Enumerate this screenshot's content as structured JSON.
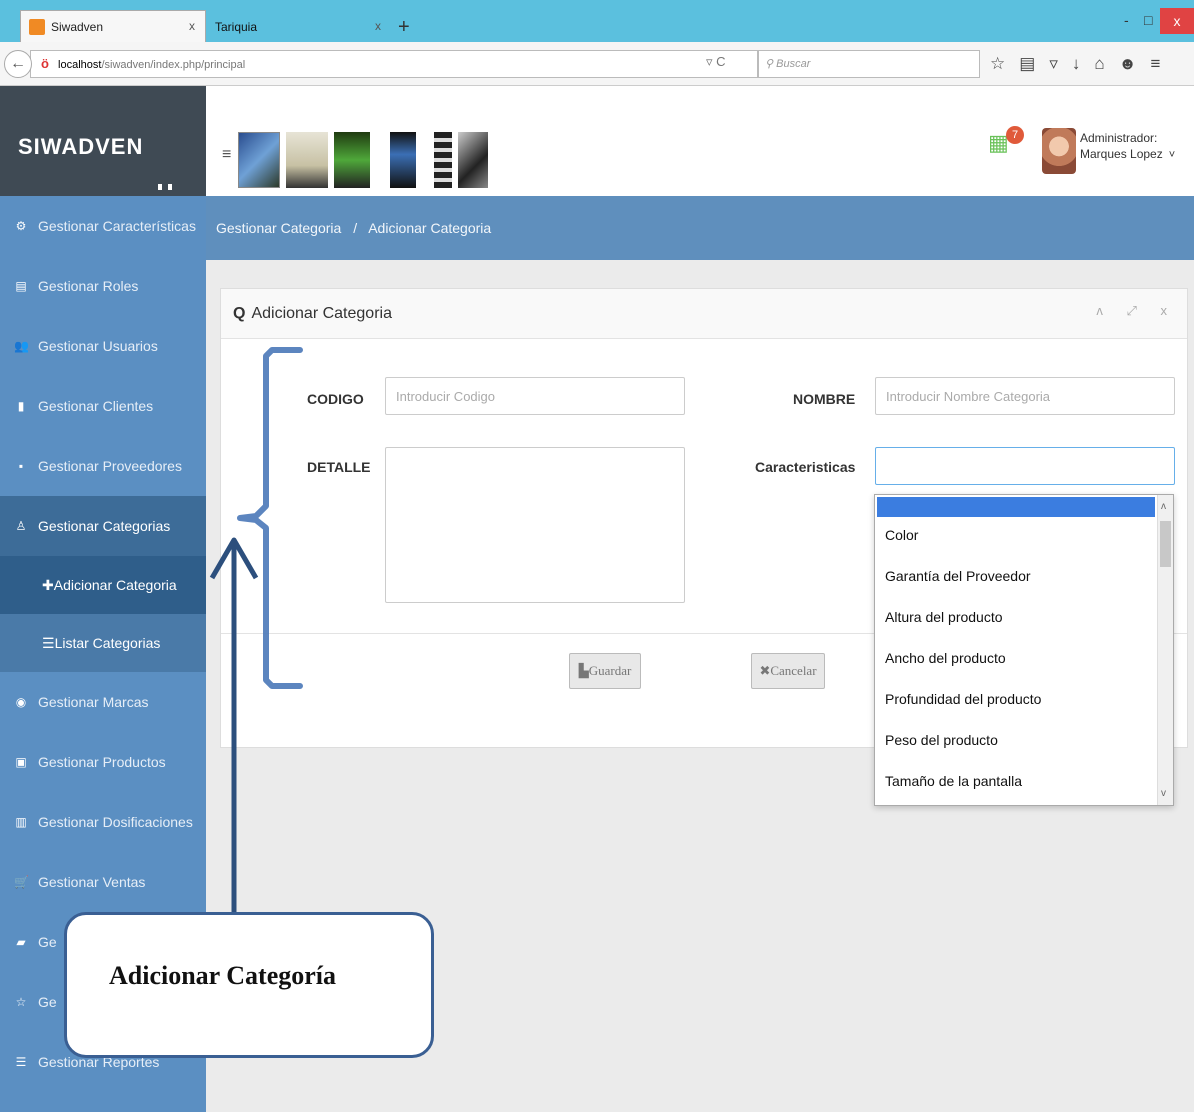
{
  "browser": {
    "tabs": [
      {
        "title": "Siwadven",
        "close": "x"
      },
      {
        "title": "Tariquia",
        "close": "x"
      }
    ],
    "new_tab": "+",
    "window_close": "x",
    "minimize": "-",
    "maximize": "□",
    "url_host": "localhost",
    "url_path": "/siwadven/index.php/principal",
    "reload": "▿ C",
    "search_placeholder": "Buscar",
    "toolbar_icons": [
      "star-icon",
      "bookmarks-icon",
      "pocket-icon",
      "download-icon",
      "home-icon",
      "hello-icon",
      "menu-icon"
    ]
  },
  "header": {
    "brand": "SIWADVEN",
    "hamburger": "≡",
    "notification_count": "7",
    "user_role": "Administrador:",
    "user_name": "Marques Lopez",
    "user_chevron": "˅"
  },
  "sidebar": {
    "items": [
      {
        "label": "Gestionar Características",
        "icon": "cogs-icon",
        "glyph": "⚙"
      },
      {
        "label": "Gestionar Roles",
        "icon": "id-card-icon",
        "glyph": "▤"
      },
      {
        "label": "Gestionar Usuarios",
        "icon": "users-icon",
        "glyph": "👥"
      },
      {
        "label": "Gestionar Clientes",
        "icon": "briefcase-icon",
        "glyph": "▮"
      },
      {
        "label": "Gestionar Proveedores",
        "icon": "truck-icon",
        "glyph": "▪"
      },
      {
        "label": "Gestionar Categorias",
        "icon": "sitemap-icon",
        "glyph": "♙"
      },
      {
        "label": "Gestionar Marcas",
        "icon": "circle-icon",
        "glyph": "◉"
      },
      {
        "label": "Gestionar Productos",
        "icon": "box-icon",
        "glyph": "▣"
      },
      {
        "label": "Gestionar Dosificaciones",
        "icon": "file-icon",
        "glyph": "▥"
      },
      {
        "label": "Gestionar Ventas",
        "icon": "cart-icon",
        "glyph": "🛒"
      },
      {
        "label": "Ge",
        "icon": "book-icon",
        "glyph": "▰"
      },
      {
        "label": "Ge",
        "icon": "star-icon",
        "glyph": "☆"
      },
      {
        "label": "Gestionar Reportes",
        "icon": "list-icon",
        "glyph": "☰"
      }
    ],
    "sub_items": [
      {
        "label": "Adicionar Categoria",
        "glyph": "✚"
      },
      {
        "label": "Listar Categorias",
        "glyph": "☰"
      }
    ]
  },
  "breadcrumb": {
    "parent": "Gestionar Categoria",
    "separator": "/",
    "current": "Adicionar Categoria"
  },
  "form": {
    "title": "Adicionar Categoria",
    "title_icon": "Q",
    "tools": "ʌ ⤢ x",
    "codigo_label": "CODIGO",
    "codigo_placeholder": "Introducir Codigo",
    "nombre_label": "NOMBRE",
    "nombre_placeholder": "Introducir Nombre Categoria",
    "detalle_label": "DETALLE",
    "caracteristicas_label": "Caracteristicas",
    "guardar": "Guardar",
    "cancelar": "Cancelar",
    "options": [
      "Color",
      "Garantía del Proveedor",
      "Altura del producto",
      "Ancho del producto",
      "Profundidad del producto",
      "Peso del producto",
      "Tamaño de la pantalla"
    ]
  },
  "annotation": {
    "text": "Adicionar Categoría"
  },
  "colors": {
    "sidebar": "#5b8fc2",
    "brand": "#3f4a54",
    "breadcrumb": "#5f8fbd",
    "annotation_border": "#3a5f93"
  }
}
